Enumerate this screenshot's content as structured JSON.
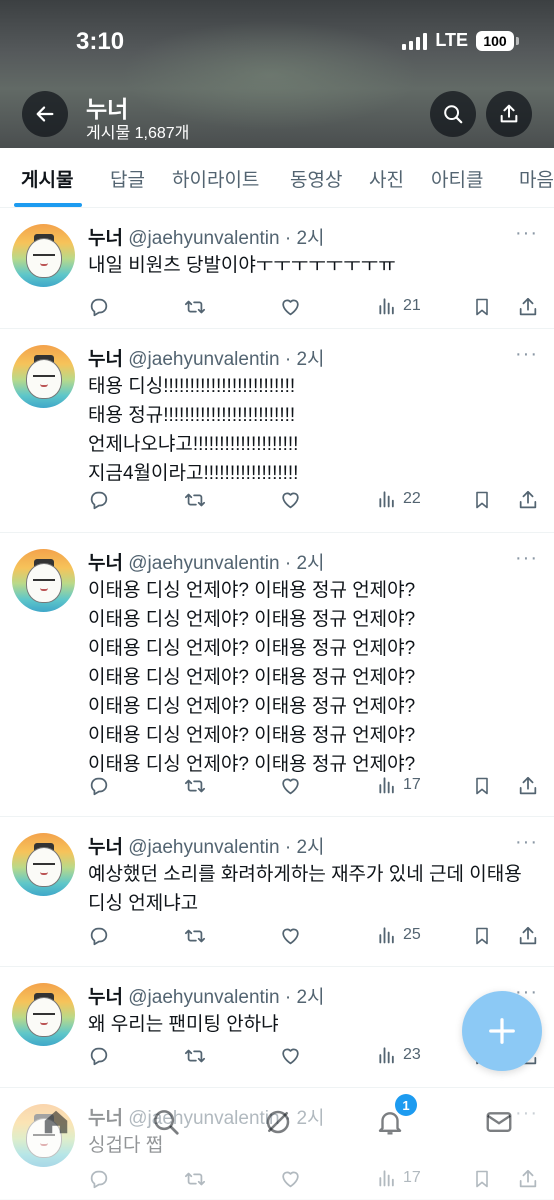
{
  "status_bar": {
    "time": "3:10",
    "network": "LTE",
    "battery": "100"
  },
  "header": {
    "title": "누너",
    "subtitle": "게시물 1,687개"
  },
  "tabs": [
    {
      "label": "게시물",
      "active": true
    },
    {
      "label": "답글"
    },
    {
      "label": "하이라이트"
    },
    {
      "label": "동영상"
    },
    {
      "label": "사진"
    },
    {
      "label": "아티클"
    },
    {
      "label": "마음"
    }
  ],
  "tweets": [
    {
      "name": "누너",
      "handle": "@jaehyunvalentin",
      "time": "2시",
      "text": "내일 비원츠 당발이야ㅜㅜㅜㅜㅜㅜㅜㅠ",
      "views": "21"
    },
    {
      "name": "누너",
      "handle": "@jaehyunvalentin",
      "time": "2시",
      "text": "태용 디싱!!!!!!!!!!!!!!!!!!!!!!!!!\n태용 정규!!!!!!!!!!!!!!!!!!!!!!!!!\n언제나오냐고!!!!!!!!!!!!!!!!!!!!\n지금4월이라고!!!!!!!!!!!!!!!!!!",
      "views": "22"
    },
    {
      "name": "누너",
      "handle": "@jaehyunvalentin",
      "time": "2시",
      "text": "이태용 디싱 언제야? 이태용 정규 언제야?\n이태용 디싱 언제야? 이태용 정규 언제야?\n이태용 디싱 언제야? 이태용 정규 언제야?\n이태용 디싱 언제야? 이태용 정규 언제야?\n이태용 디싱 언제야? 이태용 정규 언제야?\n이태용 디싱 언제야? 이태용 정규 언제야?\n이태용 디싱 언제야? 이태용 정규 언제야?",
      "views": "17"
    },
    {
      "name": "누너",
      "handle": "@jaehyunvalentin",
      "time": "2시",
      "text": "예상했던 소리를 화려하게하는 재주가 있네 근데 이태용\n디싱 언제냐고",
      "views": "25"
    },
    {
      "name": "누너",
      "handle": "@jaehyunvalentin",
      "time": "2시",
      "text": "왜 우리는 팬미팅 안하냐",
      "views": "23"
    },
    {
      "name": "누너",
      "handle": "@jaehyunvalentin",
      "time": "2시",
      "text": "싱겁다 쩝",
      "views": "17"
    }
  ],
  "tweet_more_glyph": "···",
  "bottom_nav": {
    "notification_count": "1"
  },
  "colors": {
    "accent": "#1d9bf0",
    "secondary_text": "#536471",
    "primary_text": "#0f1419"
  },
  "icons": {
    "nav": [
      "home-icon",
      "search-icon",
      "grok-icon",
      "bell-icon",
      "mail-icon"
    ],
    "tweet_actions": [
      "reply-icon",
      "retweet-icon",
      "like-icon",
      "views-icon",
      "bookmark-icon",
      "share-icon"
    ]
  }
}
